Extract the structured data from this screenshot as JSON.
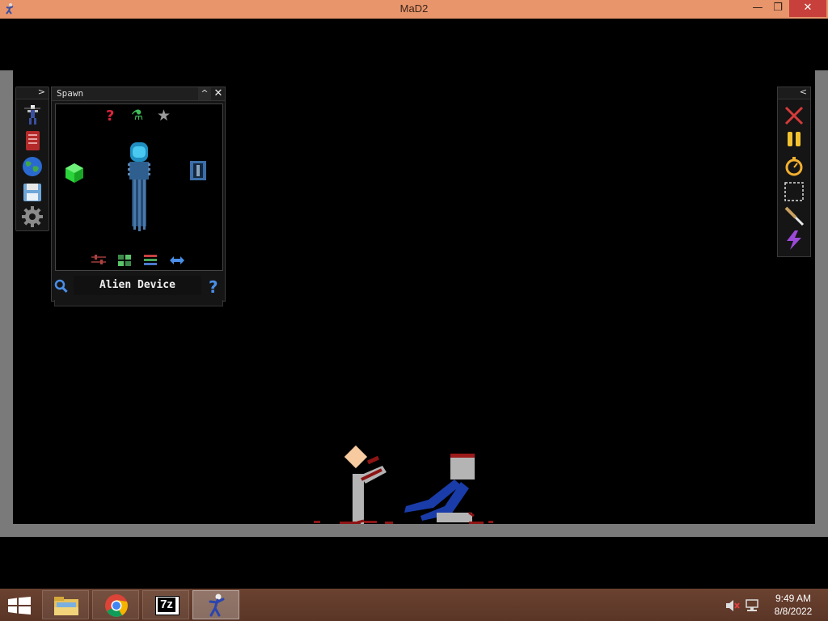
{
  "window": {
    "title": "MaD2",
    "minimize": "—",
    "maximize": "❐",
    "close": "✕"
  },
  "left_toolbar": {
    "toggle": ">",
    "buttons": [
      {
        "name": "ragdoll-spawn-icon"
      },
      {
        "name": "red-book-icon"
      },
      {
        "name": "earth-globe-icon"
      },
      {
        "name": "save-disk-icon"
      },
      {
        "name": "settings-gear-icon"
      }
    ]
  },
  "spawn_panel": {
    "title": "Spawn",
    "collapse": "^",
    "close": "✕",
    "tabs": [
      {
        "name": "random-question-icon",
        "glyph": "?",
        "color": "#d9253a"
      },
      {
        "name": "flask-icon",
        "glyph": "⚗",
        "color": "#3fbf5a"
      },
      {
        "name": "star-icon",
        "glyph": "★",
        "color": "#9a9a9a"
      }
    ],
    "selected_item": "Alien Device",
    "bottom_tools": [
      {
        "name": "sliders-icon"
      },
      {
        "name": "grid-icon"
      },
      {
        "name": "layers-icon"
      },
      {
        "name": "swap-arrows-icon"
      }
    ],
    "help": "?"
  },
  "right_toolbar": {
    "toggle": "<",
    "buttons": [
      {
        "name": "delete-x-icon"
      },
      {
        "name": "pause-icon"
      },
      {
        "name": "stopwatch-icon"
      },
      {
        "name": "select-box-icon"
      },
      {
        "name": "knife-icon"
      },
      {
        "name": "lightning-icon"
      }
    ]
  },
  "taskbar": {
    "apps": [
      {
        "name": "start-button"
      },
      {
        "name": "file-explorer-icon"
      },
      {
        "name": "chrome-icon"
      },
      {
        "name": "7zip-icon",
        "label": "7z"
      },
      {
        "name": "mad2-taskbar-icon"
      }
    ],
    "time": "9:49 AM",
    "date": "8/8/2022"
  },
  "colors": {
    "titlebar": "#e8956c",
    "wall": "#7a7a7a",
    "blood": "#9b1a1a",
    "ragdoll_blue": "#1a3ca8"
  }
}
